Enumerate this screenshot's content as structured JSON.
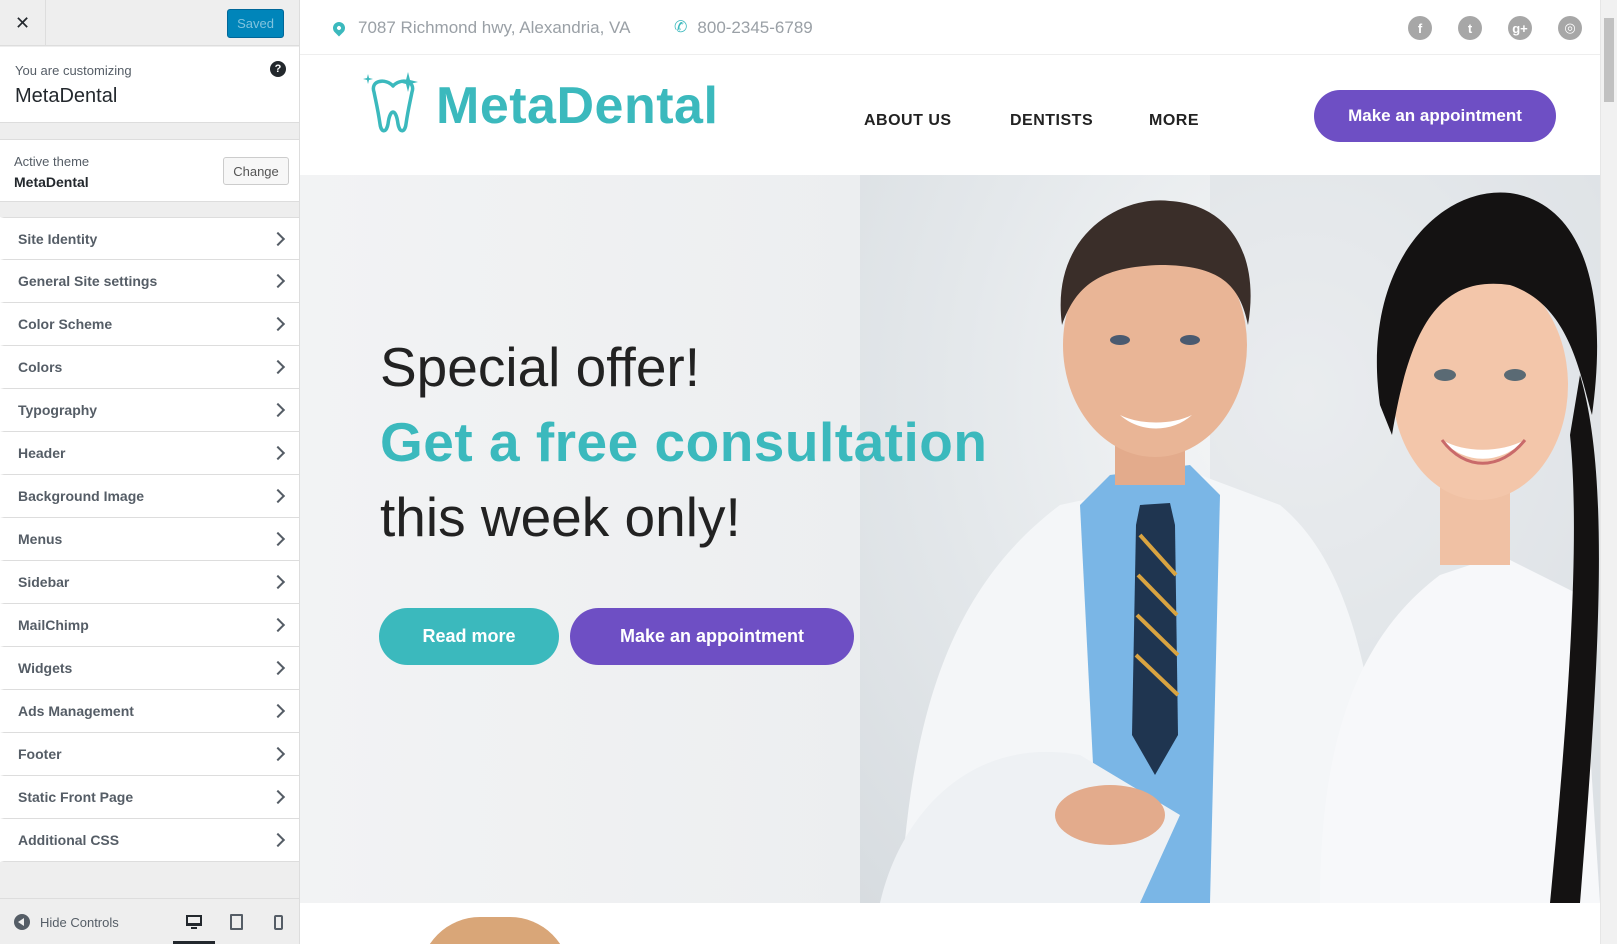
{
  "customizer": {
    "close_label": "✕",
    "saved_label": "Saved",
    "customizing_label": "You are customizing",
    "site_title": "MetaDental",
    "help_icon": "?",
    "active_theme_label": "Active theme",
    "active_theme_name": "MetaDental",
    "change_label": "Change",
    "sections": [
      {
        "label": "Site Identity"
      },
      {
        "label": "General Site settings"
      },
      {
        "label": "Color Scheme"
      },
      {
        "label": "Colors"
      },
      {
        "label": "Typography"
      },
      {
        "label": "Header"
      },
      {
        "label": "Background Image"
      },
      {
        "label": "Menus"
      },
      {
        "label": "Sidebar"
      },
      {
        "label": "MailChimp"
      },
      {
        "label": "Widgets"
      },
      {
        "label": "Ads Management"
      },
      {
        "label": "Footer"
      },
      {
        "label": "Static Front Page"
      },
      {
        "label": "Additional CSS"
      }
    ],
    "hide_controls_label": "Hide Controls",
    "devices": [
      "desktop-icon",
      "tablet-icon",
      "mobile-icon"
    ]
  },
  "preview": {
    "topbar": {
      "address": "7087 Richmond hwy, Alexandria, VA",
      "phone": "800-2345-6789",
      "social": [
        {
          "icon": "facebook-icon",
          "glyph": "f"
        },
        {
          "icon": "twitter-icon",
          "glyph": "t"
        },
        {
          "icon": "google-plus-icon",
          "glyph": "g+"
        },
        {
          "icon": "instagram-icon",
          "glyph": "◎"
        }
      ]
    },
    "header": {
      "logo_text": "MetaDental",
      "nav": [
        "ABOUT US",
        "DENTISTS",
        "MORE"
      ],
      "cta": "Make an appointment"
    },
    "hero": {
      "line1": "Special offer!",
      "line2": "Get a free consultation",
      "line3": "this week only!",
      "read_more": "Read more",
      "appointment": "Make an appointment"
    },
    "colors": {
      "teal": "#3bb9bd",
      "purple": "#6e4fc4",
      "wp_blue": "#0085ba"
    }
  }
}
